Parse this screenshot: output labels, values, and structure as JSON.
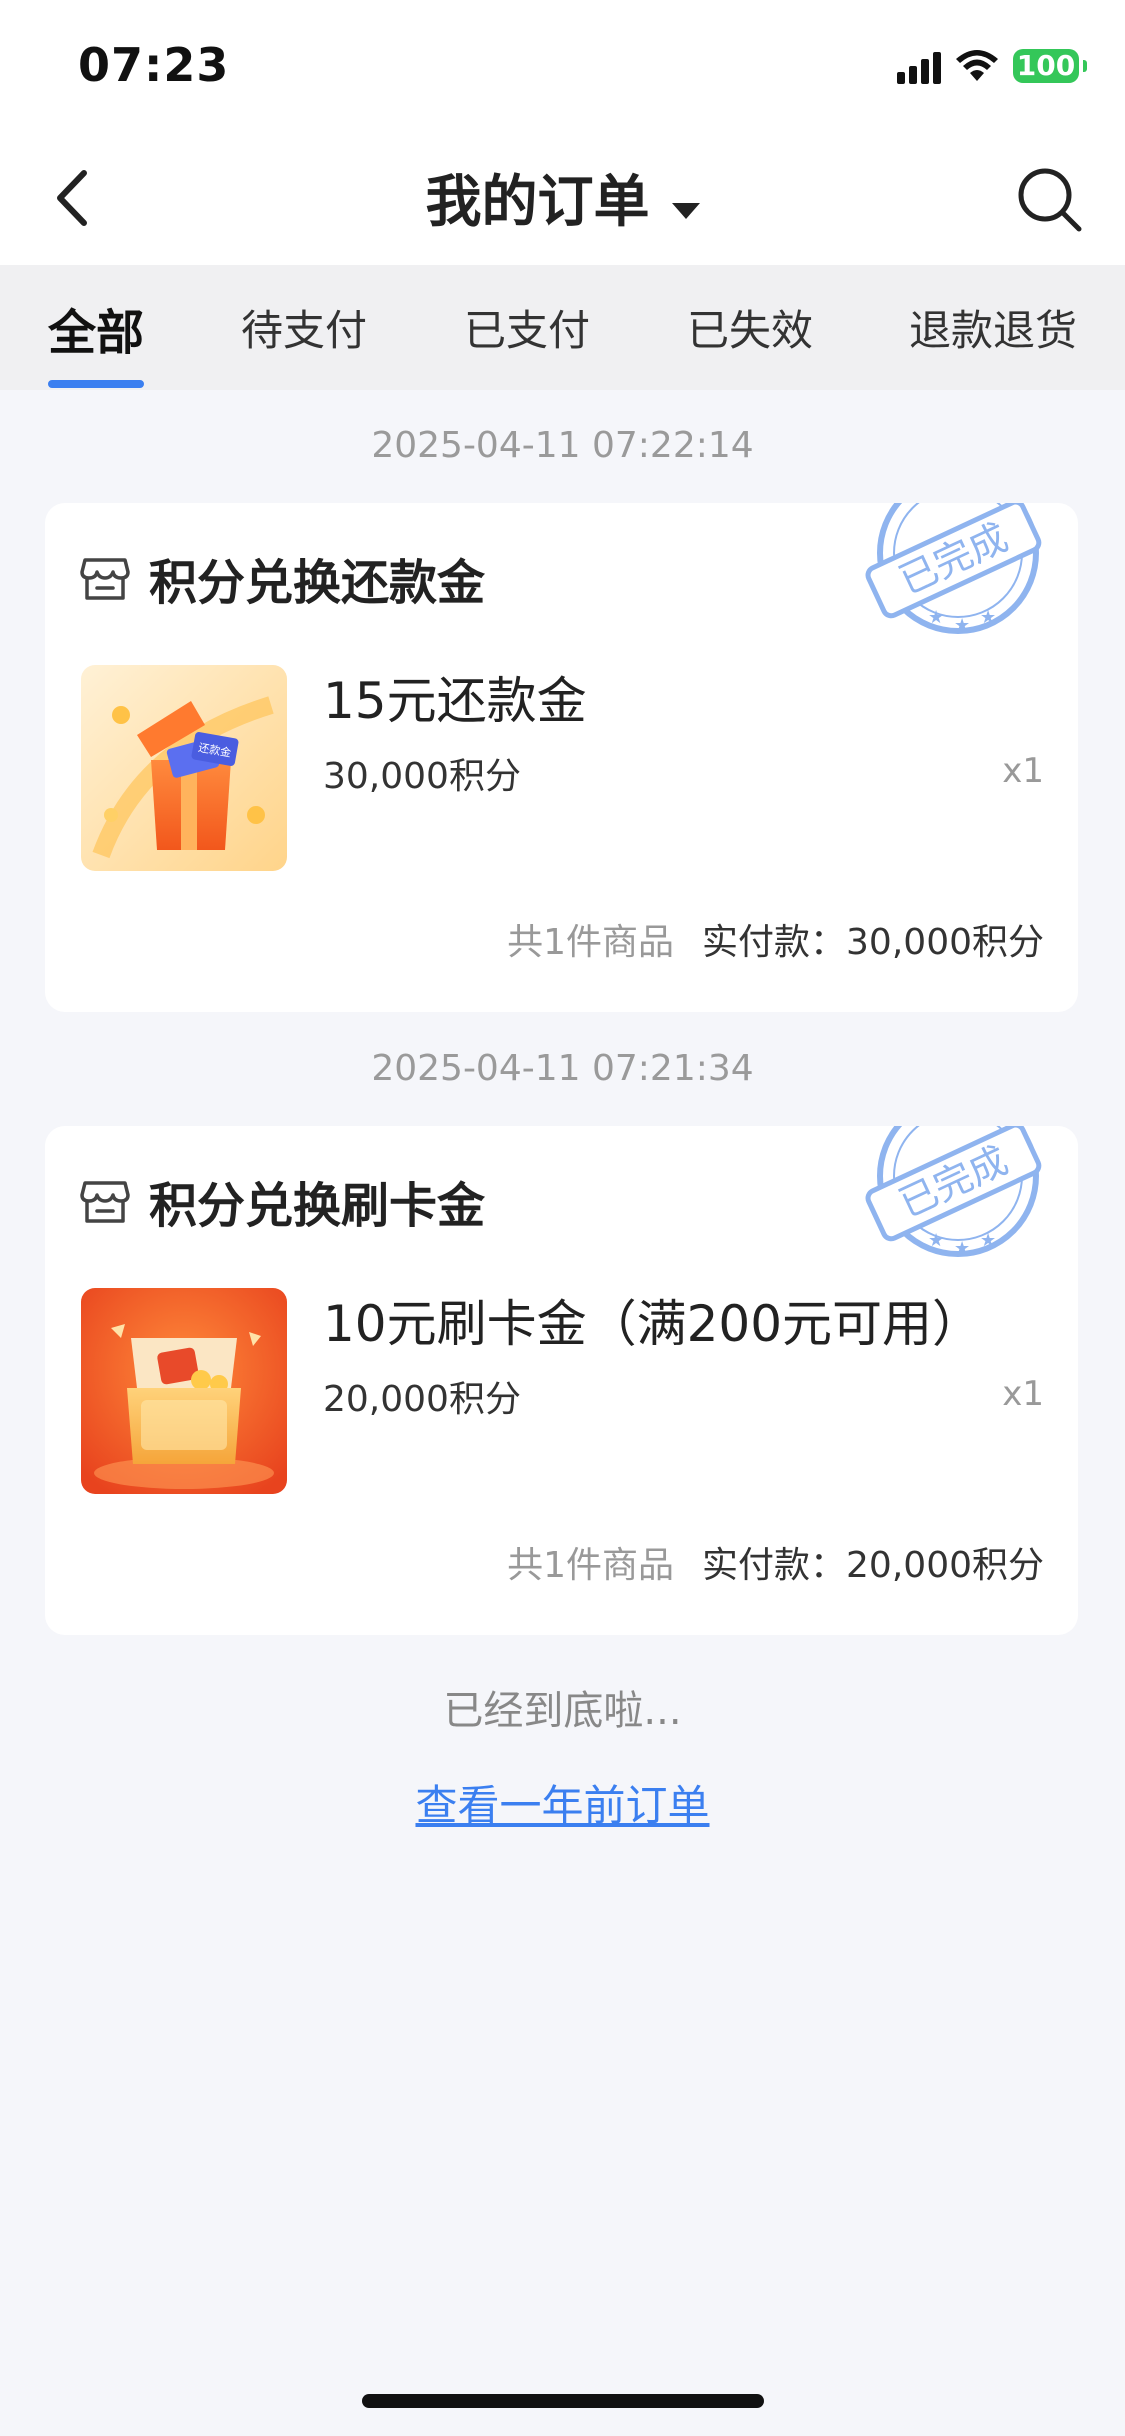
{
  "status_bar": {
    "time": "07:23",
    "battery": "100"
  },
  "nav": {
    "title": "我的订单"
  },
  "tabs": [
    {
      "label": "全部",
      "active": true
    },
    {
      "label": "待支付",
      "active": false
    },
    {
      "label": "已支付",
      "active": false
    },
    {
      "label": "已失效",
      "active": false
    },
    {
      "label": "退款退货",
      "active": false
    }
  ],
  "orders": [
    {
      "timestamp": "2025-04-11 07:22:14",
      "title": "积分兑换还款金",
      "stamp": "已完成",
      "product_name": "15元还款金",
      "points": "30,000积分",
      "qty": "x1",
      "count_text": "共1件商品",
      "paid_text": "实付款：30,000积分",
      "thumb_badge": "还款金"
    },
    {
      "timestamp": "2025-04-11 07:21:34",
      "title": "积分兑换刷卡金",
      "stamp": "已完成",
      "product_name": "10元刷卡金（满200元可用）",
      "points": "20,000积分",
      "qty": "x1",
      "count_text": "共1件商品",
      "paid_text": "实付款：20,000积分"
    }
  ],
  "footer": {
    "end_text": "已经到底啦...",
    "history_link": "查看一年前订单"
  },
  "colors": {
    "accent": "#3b7ff0",
    "stamp": "#8fb4ef",
    "battery": "#34c759"
  }
}
